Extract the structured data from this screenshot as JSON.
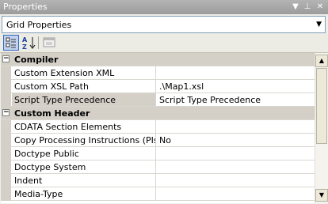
{
  "window": {
    "title": "Properties",
    "buttons": {
      "dropdown": "▼",
      "pin": "⊥",
      "close": "✕"
    }
  },
  "object_selector": {
    "value": "Grid Properties",
    "arrow": "▼"
  },
  "toolbar": {
    "categorized_icon": "categorized-icon",
    "alphabetical_icon": "alphabetical-icon",
    "property_pages_icon": "property-pages-icon"
  },
  "grid": {
    "rows": [
      {
        "type": "category",
        "expander": "−",
        "label": "Compiler"
      },
      {
        "type": "property",
        "name": "Custom Extension XML",
        "value": ""
      },
      {
        "type": "property",
        "name": "Custom XSL Path",
        "value": ".\\Map1.xsl"
      },
      {
        "type": "property",
        "name": "Script Type Precedence",
        "value": "Script Type Precedence",
        "selected": true
      },
      {
        "type": "category",
        "expander": "−",
        "label": "Custom Header"
      },
      {
        "type": "property",
        "name": "CDATA Section Elements",
        "value": ""
      },
      {
        "type": "property",
        "name": "Copy Processing Instructions (PIs)",
        "value": "No"
      },
      {
        "type": "property",
        "name": "Doctype Public",
        "value": ""
      },
      {
        "type": "property",
        "name": "Doctype System",
        "value": ""
      },
      {
        "type": "property",
        "name": "Indent",
        "value": ""
      },
      {
        "type": "property",
        "name": "Media-Type",
        "value": ""
      }
    ]
  },
  "scrollbar": {
    "up_arrow": "▲",
    "down_arrow": "▼"
  }
}
